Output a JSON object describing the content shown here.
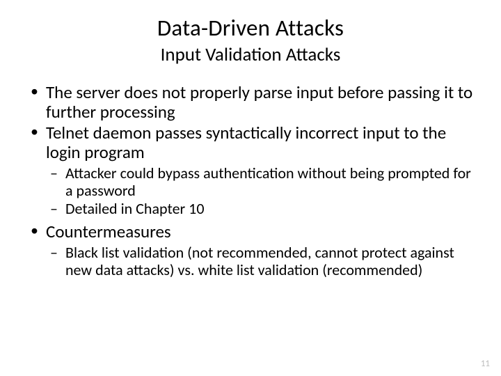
{
  "title": "Data-Driven Attacks",
  "subtitle": "Input Validation Attacks",
  "bullets": {
    "b1": "The server does not properly parse input before passing it to further processing",
    "b2": "Telnet daemon passes syntactically incorrect input to the login program",
    "b2_sub": {
      "s1": "Attacker could bypass authentication without being prompted for a password",
      "s2": "Detailed in Chapter 10"
    },
    "b3": "Countermeasures",
    "b3_sub": {
      "s1": "Black list validation (not recommended, cannot protect against new data attacks) vs. white list validation (recommended)"
    }
  },
  "page_number": "11"
}
